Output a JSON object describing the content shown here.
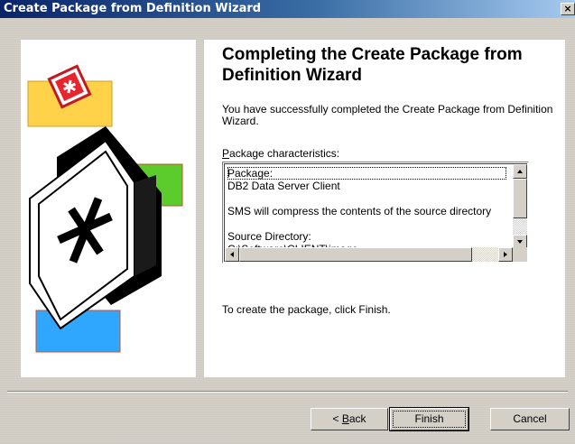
{
  "window": {
    "title": "Create Package from Definition Wizard",
    "close_glyph": "×"
  },
  "wizard": {
    "heading": "Completing the Create Package from Definition Wizard",
    "description": "You have successfully completed the Create Package from Definition Wizard.",
    "characteristics_label_accel": "P",
    "characteristics_label_rest": "ackage characteristics:",
    "lines": [
      "Package:",
      "DB2 Data Server Client",
      "",
      "SMS will compress the contents of the source directory",
      "",
      "Source Directory:",
      "C:\\Software\\CLIENT\\image"
    ],
    "finish_instruction": "To create the package, click Finish."
  },
  "buttons": {
    "back_prefix": "< ",
    "back_accel": "B",
    "back_rest": "ack",
    "finish": "Finish",
    "cancel": "Cancel"
  },
  "colors": {
    "titlebar_start": "#0a246a",
    "titlebar_end": "#a6caf0",
    "icon_red": "#e8242c",
    "yellow": "#ffd24a",
    "green": "#5ccc2c",
    "blue": "#2fa7ff"
  },
  "icons": {
    "decoration": "sms-package-asterisk-icon"
  }
}
